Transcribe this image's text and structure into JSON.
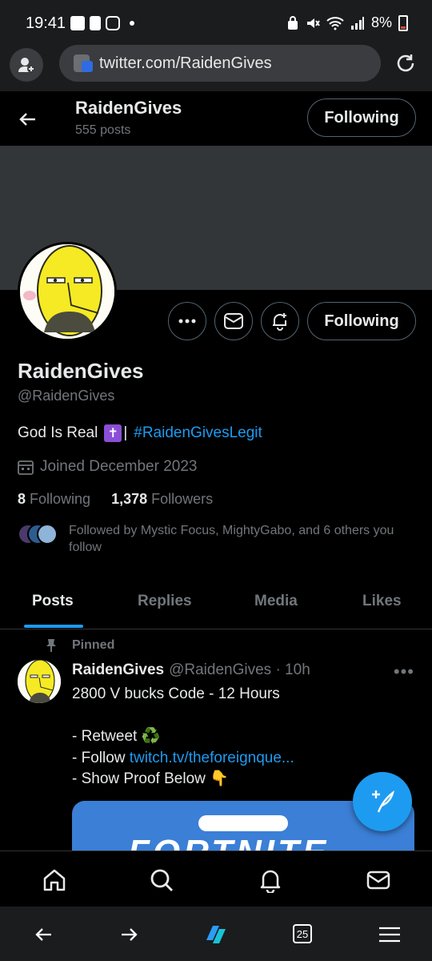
{
  "status_bar": {
    "time": "19:41",
    "battery": "8%"
  },
  "browser": {
    "url": "twitter.com/RaidenGives",
    "tab_count": "25"
  },
  "header": {
    "name": "RaidenGives",
    "post_count": "555 posts",
    "follow_label": "Following"
  },
  "profile": {
    "name": "RaidenGives",
    "handle": "@RaidenGives",
    "bio_text": "God Is Real",
    "bio_badge": "✝",
    "bio_separator": "|",
    "bio_hashtag": "#RaidenGivesLegit",
    "joined": "Joined December 2023",
    "following_count": "8",
    "following_label": "Following",
    "followers_count": "1,378",
    "followers_label": "Followers",
    "followed_by": "Followed by Mystic Focus, MightyGabo, and 6 others you follow",
    "follow_label": "Following"
  },
  "tabs": [
    "Posts",
    "Replies",
    "Media",
    "Likes"
  ],
  "tweet": {
    "pinned_label": "Pinned",
    "author": "RaidenGives",
    "handle_time": "@RaidenGives · 10h",
    "lines": [
      "2800 V bucks Code - 12 Hours",
      "",
      "- Retweet ♻️",
      "- Follow ",
      "- Show Proof Below 👇"
    ],
    "link": "twitch.tv/theforeignque...",
    "media_text": "FORTNITE"
  },
  "colors": {
    "accent": "#1d9bf0",
    "banner": "#333639",
    "muted": "#71767b"
  }
}
